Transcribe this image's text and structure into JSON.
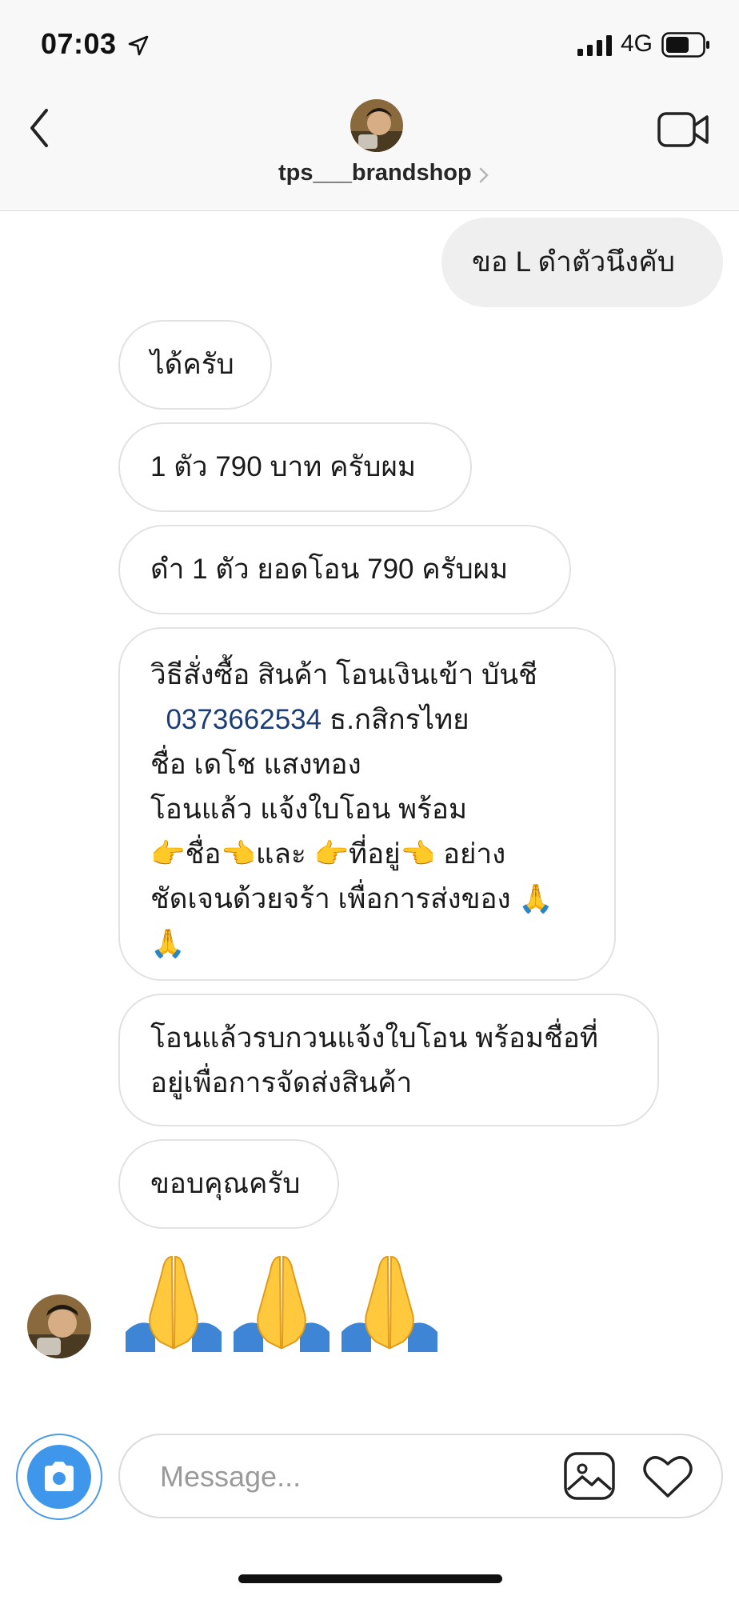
{
  "status_bar": {
    "time": "07:03",
    "network": "4G"
  },
  "header": {
    "username": "tps___brandshop"
  },
  "messages": [
    {
      "from": "me",
      "text": "ขอ L ดำตัวนึงคับ"
    },
    {
      "from": "them",
      "text": "ได้ครับ"
    },
    {
      "from": "them",
      "text": "1 ตัว 790 บาท ครับผม"
    },
    {
      "from": "them",
      "text": "ดำ 1 ตัว ยอดโอน 790 ครับผม"
    },
    {
      "from": "them",
      "line1": "วิธีสั่งซื้อ สินค้า โอนเงินเข้า บันชี",
      "account": "0373662534",
      "bank": " ธ.กสิกรไทย",
      "rest": "ชื่อ เดโช แสงทอง\nโอนแล้ว แจ้งใบโอน พร้อม\n👉ชื่อ👈และ 👉ที่อยู่👈 อย่าง\nชัดเจนด้วยจร้า เพื่อการส่งของ 🙏\n🙏"
    },
    {
      "from": "them",
      "text": "โอนแล้วรบกวนแจ้งใบโอน พร้อมชื่อที่\nอยู่เพื่อการจัดส่งสินค้า"
    },
    {
      "from": "them",
      "text": "ขอบคุณครับ"
    },
    {
      "from": "them",
      "emoji": [
        "🙏",
        "🙏",
        "🙏"
      ]
    }
  ],
  "composer": {
    "placeholder": "Message..."
  },
  "colors": {
    "camera_blue": "#3f97ec",
    "link_blue": "#1d3d75",
    "outgoing_bubble": "#efefef"
  },
  "icons": [
    "location-arrow-icon",
    "signal-icon",
    "battery-icon",
    "back-chevron-icon",
    "video-call-icon",
    "camera-icon",
    "gallery-icon",
    "heart-icon"
  ]
}
